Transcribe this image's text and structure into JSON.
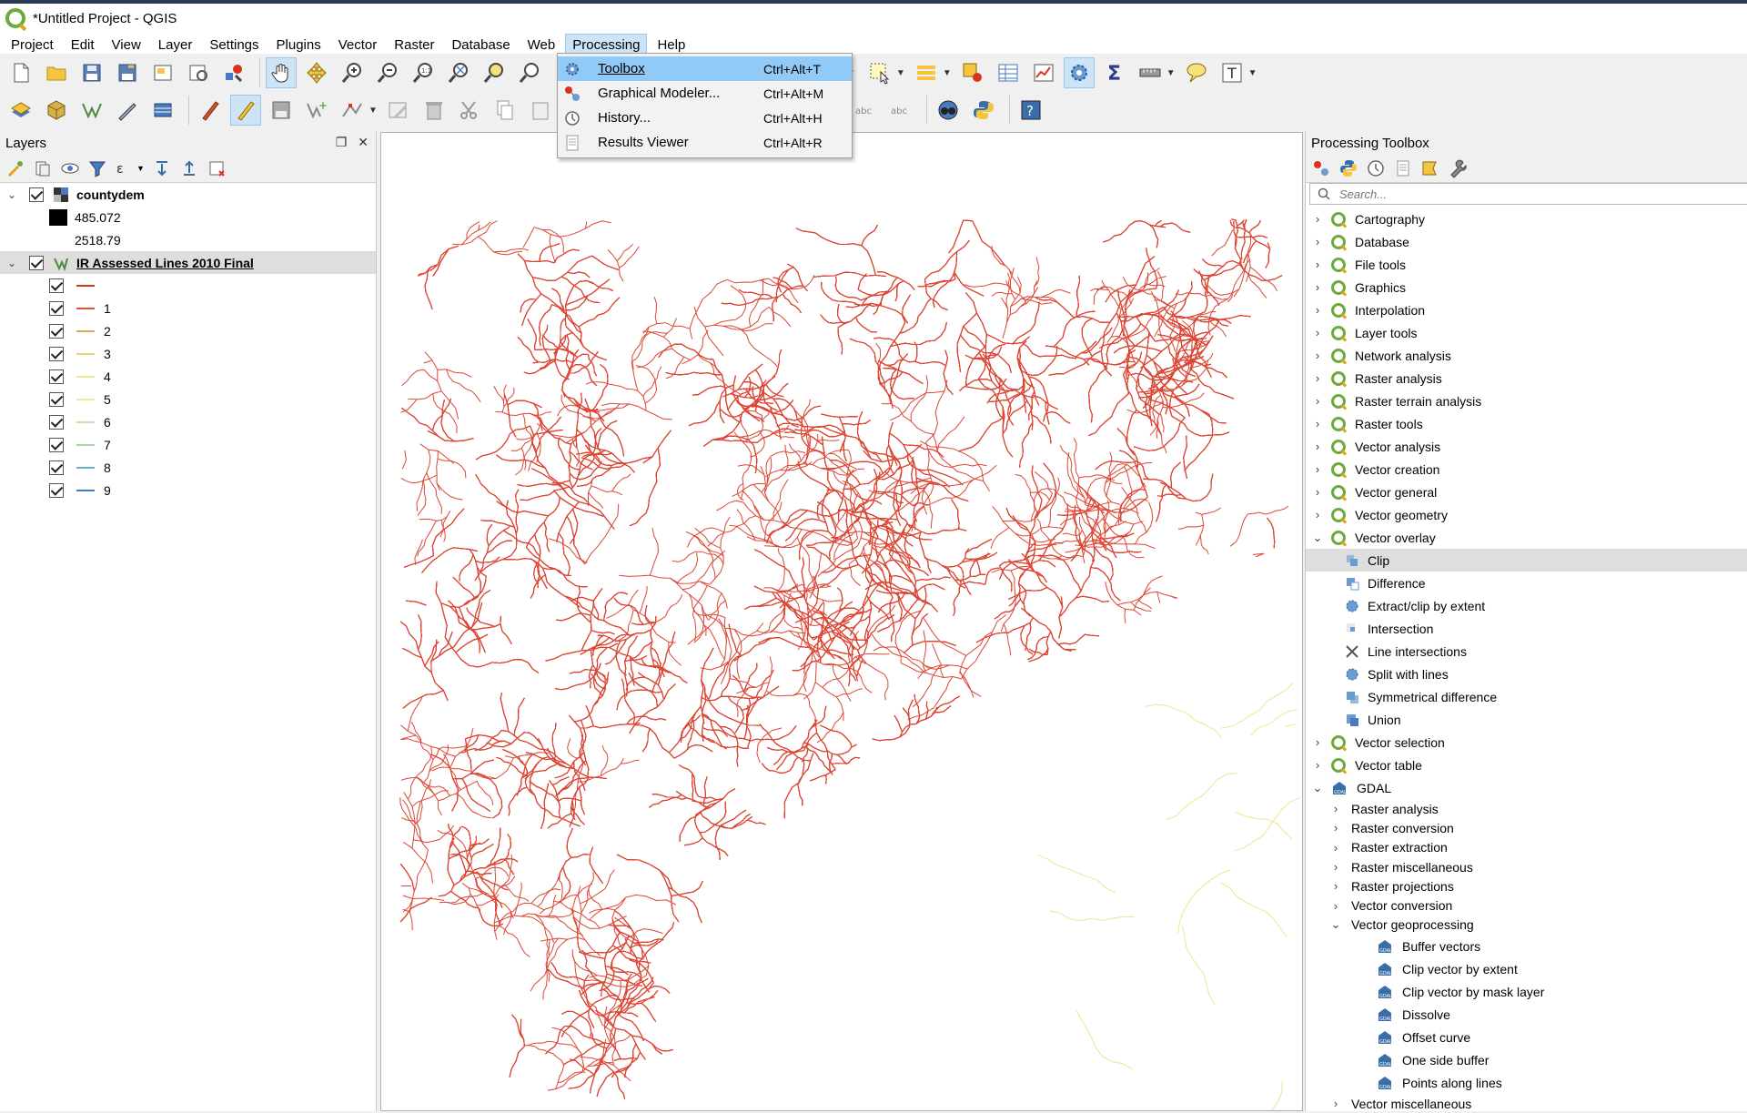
{
  "window": {
    "title": "*Untitled Project - QGIS"
  },
  "menubar": [
    "Project",
    "Edit",
    "View",
    "Layer",
    "Settings",
    "Plugins",
    "Vector",
    "Raster",
    "Database",
    "Web",
    "Processing",
    "Help"
  ],
  "processing_menu": [
    {
      "label": "Toolbox",
      "shortcut": "Ctrl+Alt+T",
      "highlighted": true
    },
    {
      "label": "Graphical Modeler...",
      "shortcut": "Ctrl+Alt+M"
    },
    {
      "label": "History...",
      "shortcut": "Ctrl+Alt+H"
    },
    {
      "label": "Results Viewer",
      "shortcut": "Ctrl+Alt+R"
    }
  ],
  "layers_panel": {
    "title": "Layers",
    "raster_layer": {
      "name": "countydem",
      "min": "485.072",
      "max": "2518.79"
    },
    "vector_layer": {
      "name": "IR Assessed Lines 2010 Final",
      "categories": [
        {
          "label": "",
          "color": "#d9321f"
        },
        {
          "label": "1",
          "color": "#d9533a"
        },
        {
          "label": "2",
          "color": "#e2a35a"
        },
        {
          "label": "3",
          "color": "#ecd27a"
        },
        {
          "label": "4",
          "color": "#efe48f"
        },
        {
          "label": "5",
          "color": "#e6eea0"
        },
        {
          "label": "6",
          "color": "#c6e4a6"
        },
        {
          "label": "7",
          "color": "#a6d6a6"
        },
        {
          "label": "8",
          "color": "#6aaed0"
        },
        {
          "label": "9",
          "color": "#3f7fbf"
        }
      ]
    }
  },
  "toolbox": {
    "title": "Processing Toolbox",
    "search_placeholder": "Search...",
    "groups_before": [
      "Cartography",
      "Database",
      "File tools",
      "Graphics",
      "Interpolation",
      "Layer tools",
      "Network analysis",
      "Raster analysis",
      "Raster terrain analysis",
      "Raster tools",
      "Vector analysis",
      "Vector creation",
      "Vector general",
      "Vector geometry"
    ],
    "expanded_group": "Vector overlay",
    "overlay_algorithms": [
      "Clip",
      "Difference",
      "Extract/clip by extent",
      "Intersection",
      "Line intersections",
      "Split with lines",
      "Symmetrical difference",
      "Union"
    ],
    "selected_algorithm": "Clip",
    "groups_after": [
      "Vector selection",
      "Vector table"
    ],
    "provider": "GDAL",
    "gdal_groups": [
      "Raster analysis",
      "Raster conversion",
      "Raster extraction",
      "Raster miscellaneous",
      "Raster projections",
      "Vector conversion"
    ],
    "gdal_expanded": "Vector geoprocessing",
    "geoprocessing_algorithms": [
      "Buffer vectors",
      "Clip vector by extent",
      "Clip vector by mask layer",
      "Dissolve",
      "Offset curve",
      "One side buffer",
      "Points along lines"
    ],
    "gdal_last": "Vector miscellaneous"
  },
  "colors": {
    "river": "#d9321f",
    "accent": "#91c9f7",
    "qgis_green": "#6bab3c"
  }
}
